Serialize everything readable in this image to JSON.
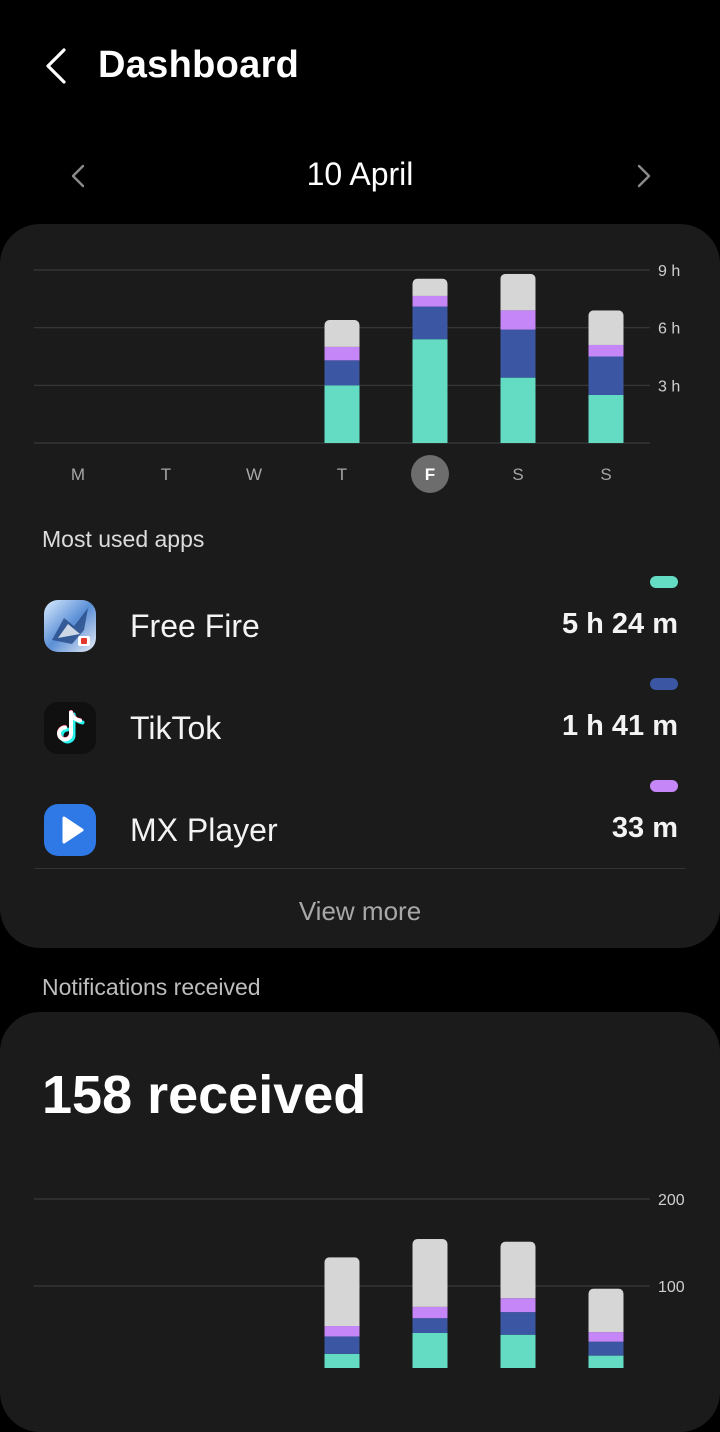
{
  "header": {
    "title": "Dashboard"
  },
  "date_nav": {
    "label": "10 April"
  },
  "usage_chart": {
    "chart_data": {
      "type": "bar",
      "stacked": true,
      "categories": [
        "M",
        "T",
        "W",
        "T",
        "F",
        "S",
        "S"
      ],
      "selected_index": 4,
      "y_ticks": [
        {
          "value": 3,
          "label": "3 h"
        },
        {
          "value": 6,
          "label": "6 h"
        },
        {
          "value": 9,
          "label": "9 h"
        }
      ],
      "ylim": [
        0,
        9
      ],
      "series": [
        {
          "name": "Free Fire",
          "color": "#63dcc3",
          "values": [
            0,
            0,
            0,
            3.0,
            5.4,
            3.4,
            2.5
          ]
        },
        {
          "name": "TikTok",
          "color": "#3b57a4",
          "values": [
            0,
            0,
            0,
            1.3,
            1.7,
            2.5,
            2.0
          ]
        },
        {
          "name": "MX Player",
          "color": "#c586f7",
          "values": [
            0,
            0,
            0,
            0.7,
            0.55,
            1.0,
            0.6
          ]
        },
        {
          "name": "Other",
          "color": "#d6d6d6",
          "values": [
            0,
            0,
            0,
            1.4,
            0.9,
            1.9,
            1.8
          ]
        }
      ]
    }
  },
  "most_used": {
    "label": "Most used apps",
    "apps": [
      {
        "name": "Free Fire",
        "time": "5 h 24 m",
        "color": "#63dcc3",
        "icon": "free-fire-icon"
      },
      {
        "name": "TikTok",
        "time": "1 h 41 m",
        "color": "#3b57a4",
        "icon": "tiktok-icon"
      },
      {
        "name": "MX Player",
        "time": "33 m",
        "color": "#c586f7",
        "icon": "mx-player-icon"
      }
    ],
    "view_more": "View more"
  },
  "notifications": {
    "label": "Notifications received",
    "count_text": "158 received",
    "chart_data": {
      "type": "bar",
      "stacked": true,
      "categories": [
        "M",
        "T",
        "W",
        "T",
        "F",
        "S",
        "S"
      ],
      "y_ticks": [
        {
          "value": 100,
          "label": "100"
        },
        {
          "value": 200,
          "label": "200"
        }
      ],
      "ylim": [
        0,
        200
      ],
      "series": [
        {
          "color": "#63dcc3",
          "values": [
            0,
            0,
            0,
            22,
            46,
            44,
            20
          ]
        },
        {
          "color": "#3b57a4",
          "values": [
            0,
            0,
            0,
            20,
            17,
            26,
            16
          ]
        },
        {
          "color": "#c586f7",
          "values": [
            0,
            0,
            0,
            12,
            13,
            16,
            11
          ]
        },
        {
          "color": "#d6d6d6",
          "values": [
            0,
            0,
            0,
            79,
            78,
            65,
            50
          ]
        }
      ]
    }
  }
}
